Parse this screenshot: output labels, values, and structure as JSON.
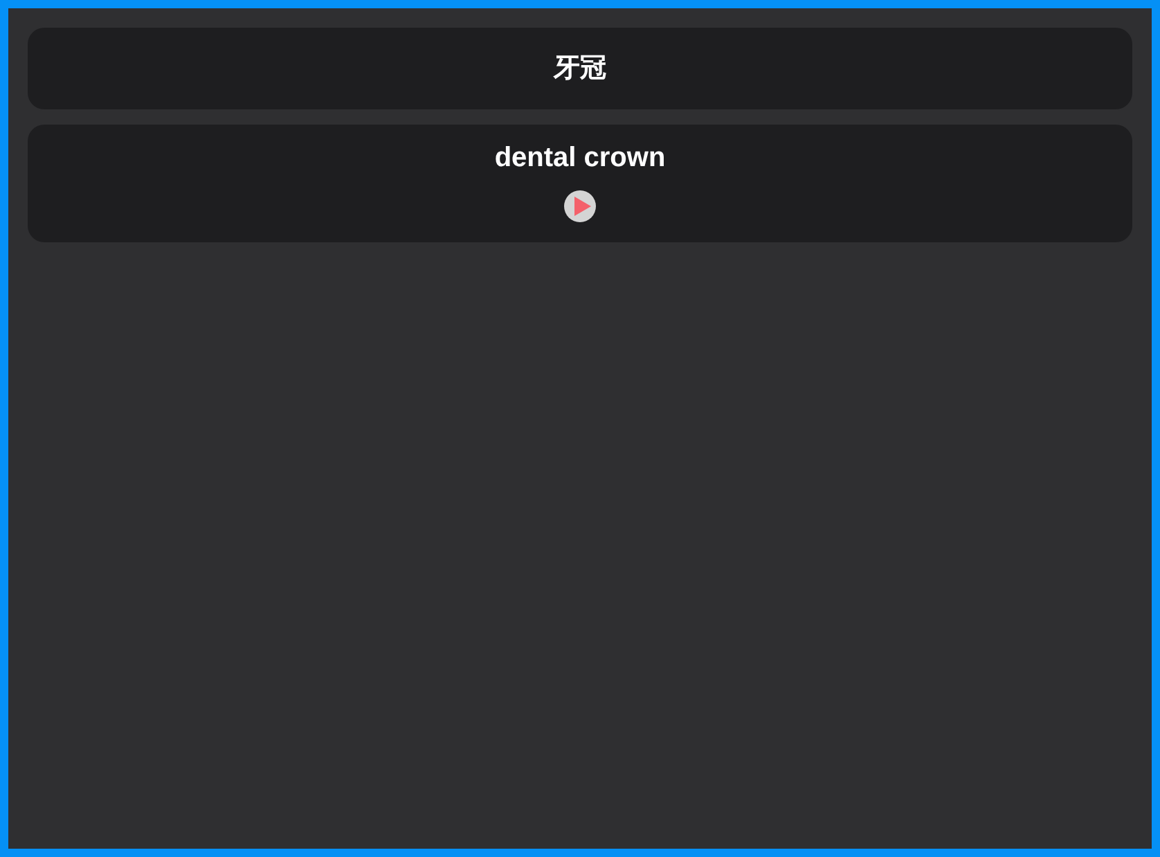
{
  "source": {
    "text": "牙冠"
  },
  "translation": {
    "text": "dental crown",
    "play_button": {
      "kind": "play"
    }
  }
}
